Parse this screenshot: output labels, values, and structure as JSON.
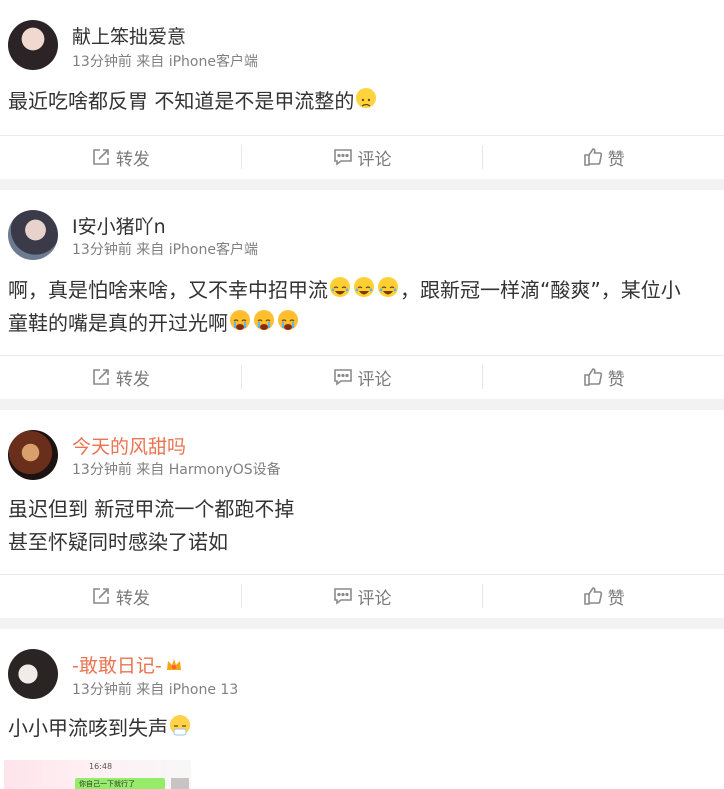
{
  "posts": [
    {
      "username": "献上笨拙爱意",
      "meta": "13分钟前 来自 iPhone客户端",
      "lines": [
        "最近吃啥都反胃 不知道是不是甲流整的"
      ],
      "actions": {
        "repost": "转发",
        "comment": "评论",
        "like": "赞"
      }
    },
    {
      "username": "I安小猪吖n",
      "meta": "13分钟前 来自 iPhone客户端",
      "lines": [
        {
          "a": "啊，真是怕啥来啥，又不幸中招甲流",
          "b": "，跟新冠一样滴“酸爽”，某位小"
        },
        {
          "a": "童鞋的嘴是真的开过光啊"
        }
      ],
      "actions": {
        "repost": "转发",
        "comment": "评论",
        "like": "赞"
      }
    },
    {
      "username": "今天的风甜吗",
      "meta": "13分钟前 来自 HarmonyOS设备",
      "lines": [
        "虽迟但到 新冠甲流一个都跑不掉",
        "甚至怀疑同时感染了诺如"
      ],
      "actions": {
        "repost": "转发",
        "comment": "评论",
        "like": "赞"
      }
    },
    {
      "username": "-敢敢日记-",
      "meta": "13分钟前 来自 iPhone 13",
      "lines": [
        "小小甲流咳到失声"
      ],
      "thumbnail": {
        "time": "16:48",
        "bubble": "你自己一下就行了"
      }
    }
  ],
  "icons": {
    "repost": "repost-icon",
    "comment": "comment-icon",
    "like": "thumbs-up-icon",
    "emoji_sad": "disappointed-face-icon",
    "emoji_laugh": "laugh-cry-face-icon",
    "emoji_cry": "crying-face-icon",
    "emoji_ill": "sick-face-icon",
    "badge": "member-crown-icon"
  },
  "colors": {
    "username_default": "#333333",
    "username_vip": "#eb7350",
    "meta": "#808080",
    "action": "#7a7a7a",
    "separator": "#f2f2f2"
  }
}
